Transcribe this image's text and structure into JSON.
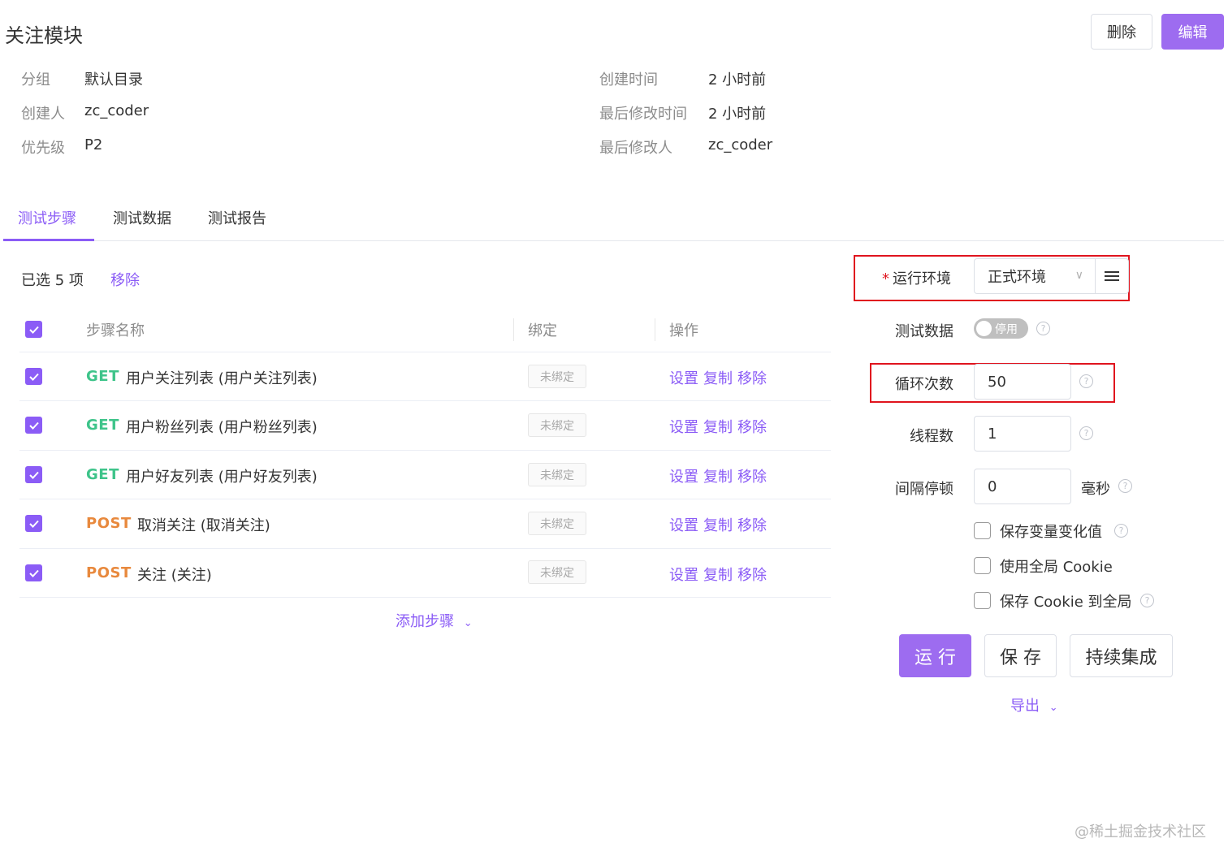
{
  "header": {
    "title": "关注模块",
    "delete_label": "删除",
    "edit_label": "编辑"
  },
  "meta": {
    "group_label": "分组",
    "group_value": "默认目录",
    "creator_label": "创建人",
    "creator_value": "zc_coder",
    "priority_label": "优先级",
    "priority_value": "P2",
    "created_label": "创建时间",
    "created_value": "2 小时前",
    "modified_label": "最后修改时间",
    "modified_value": "2 小时前",
    "modifier_label": "最后修改人",
    "modifier_value": "zc_coder"
  },
  "tabs": [
    {
      "label": "测试步骤"
    },
    {
      "label": "测试数据"
    },
    {
      "label": "测试报告"
    }
  ],
  "steps": {
    "selected_text": "已选 5 项",
    "remove_selected": "移除",
    "columns": [
      "步骤名称",
      "绑定",
      "操作"
    ],
    "rows": [
      {
        "method": "GET",
        "name": "用户关注列表 (用户关注列表)",
        "binding": "未绑定"
      },
      {
        "method": "GET",
        "name": "用户粉丝列表 (用户粉丝列表)",
        "binding": "未绑定"
      },
      {
        "method": "GET",
        "name": "用户好友列表 (用户好友列表)",
        "binding": "未绑定"
      },
      {
        "method": "POST",
        "name": "取消关注 (取消关注)",
        "binding": "未绑定"
      },
      {
        "method": "POST",
        "name": "关注 (关注)",
        "binding": "未绑定"
      }
    ],
    "actions": {
      "settings": "设置",
      "copy": "复制",
      "remove": "移除"
    },
    "add_step": "添加步骤"
  },
  "config": {
    "env_label": "运行环境",
    "env_value": "正式环境",
    "test_data_label": "测试数据",
    "toggle_label": "停用",
    "loop_label": "循环次数",
    "loop_value": "50",
    "threads_label": "线程数",
    "threads_value": "1",
    "interval_label": "间隔停顿",
    "interval_value": "0",
    "interval_unit": "毫秒",
    "save_var_label": "保存变量变化值",
    "use_cookie_label": "使用全局 Cookie",
    "save_cookie_label": "保存 Cookie 到全局",
    "run_label": "运 行",
    "save_label": "保 存",
    "ci_label": "持续集成",
    "export_label": "导出"
  },
  "colors": {
    "accent": "#8b5cf6",
    "button": "#9d6cf0",
    "get": "#3ec48a",
    "post": "#e8893d",
    "highlight": "#e0141e"
  },
  "watermark": "@稀土掘金技术社区"
}
